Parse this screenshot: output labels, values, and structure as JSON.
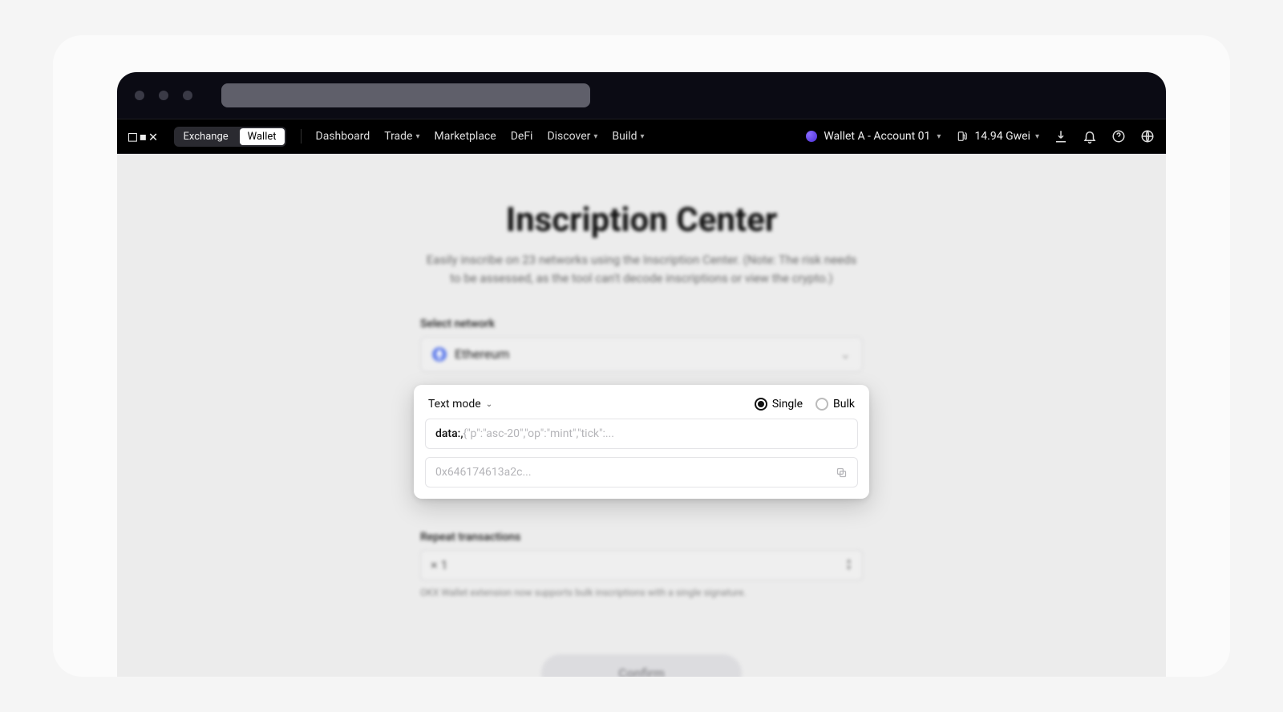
{
  "nav": {
    "logo": "OKX",
    "seg_exchange": "Exchange",
    "seg_wallet": "Wallet",
    "items": [
      {
        "label": "Dashboard",
        "caret": false
      },
      {
        "label": "Trade",
        "caret": true
      },
      {
        "label": "Marketplace",
        "caret": false
      },
      {
        "label": "DeFi",
        "caret": false
      },
      {
        "label": "Discover",
        "caret": true
      },
      {
        "label": "Build",
        "caret": true
      }
    ],
    "wallet_label": "Wallet A - Account 01",
    "gas_label": "14.94 Gwei"
  },
  "page": {
    "title": "Inscription Center",
    "subtitle": "Easily inscribe on 23 networks using the Inscription Center. (Note: The risk needs to be assessed, as the tool can't decode inscriptions or view the crypto.)",
    "select_network_label": "Select network",
    "network_value": "Ethereum",
    "repeat_label": "Repeat transactions",
    "repeat_value": "× 1",
    "hint": "OKX Wallet extension now supports bulk inscriptions with a single signature.",
    "confirm": "Confirm"
  },
  "card": {
    "mode_label": "Text mode",
    "radio_single": "Single",
    "radio_bulk": "Bulk",
    "data_prefix": "data:,",
    "data_placeholder": "{\"p\":\"asc-20\",\"op\":\"mint\",\"tick\":...",
    "hex_placeholder": "0x646174613a2c..."
  }
}
